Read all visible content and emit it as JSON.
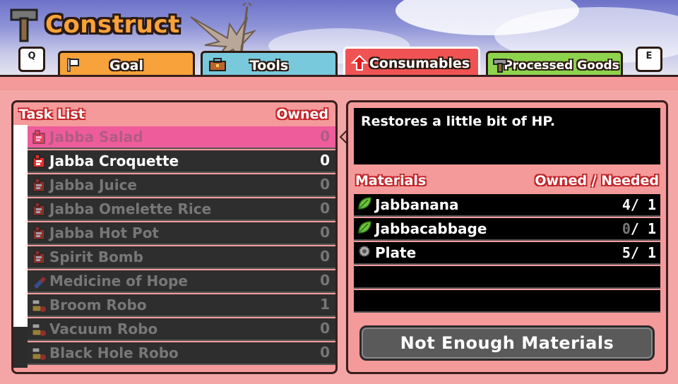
{
  "header": {
    "title": "Construct",
    "key_left": "Q",
    "key_right": "E",
    "tabs": [
      {
        "label": "Goal",
        "color": "#f7a23a"
      },
      {
        "label": "Tools",
        "color": "#79c9dc"
      },
      {
        "label": "Consumables",
        "color": "#f05353"
      },
      {
        "label": "Processed Goods",
        "color": "#8ed34e"
      }
    ],
    "active_tab": "Consumables"
  },
  "task_list": {
    "title": "Task List",
    "owned_header": "Owned",
    "scroll_fraction": 0.83,
    "items": [
      {
        "name": "Jabba Salad",
        "owned": "0",
        "icon": "recipe-icon",
        "state": "selected"
      },
      {
        "name": "Jabba Croquette",
        "owned": "0",
        "icon": "recipe-icon",
        "state": "active"
      },
      {
        "name": "Jabba Juice",
        "owned": "0",
        "icon": "recipe-icon",
        "state": "dim"
      },
      {
        "name": "Jabba Omelette Rice",
        "owned": "0",
        "icon": "recipe-icon",
        "state": "dim"
      },
      {
        "name": "Jabba Hot Pot",
        "owned": "0",
        "icon": "recipe-icon",
        "state": "dim"
      },
      {
        "name": "Spirit Bomb",
        "owned": "0",
        "icon": "recipe-icon",
        "state": "dim"
      },
      {
        "name": "Medicine of Hope",
        "owned": "0",
        "icon": "capsule-icon",
        "state": "dim"
      },
      {
        "name": "Broom Robo",
        "owned": "1",
        "icon": "robo-icon",
        "state": "dim"
      },
      {
        "name": "Vacuum Robo",
        "owned": "0",
        "icon": "robo-icon",
        "state": "dim"
      },
      {
        "name": "Black Hole Robo",
        "owned": "0",
        "icon": "robo-icon",
        "state": "dim"
      }
    ]
  },
  "detail": {
    "description": "Restores a little bit of HP.",
    "materials_header": "Materials",
    "owned_needed_header": "Owned / Needed",
    "materials": [
      {
        "name": "Jabbanana",
        "owned": "4",
        "needed": "1",
        "icon": "leaf-icon"
      },
      {
        "name": "Jabbacabbage",
        "owned": "0",
        "needed": "1",
        "icon": "leaf-icon"
      },
      {
        "name": "Plate",
        "owned": "5",
        "needed": "1",
        "icon": "gear-icon"
      }
    ],
    "craft_button": "Not Enough Materials"
  }
}
